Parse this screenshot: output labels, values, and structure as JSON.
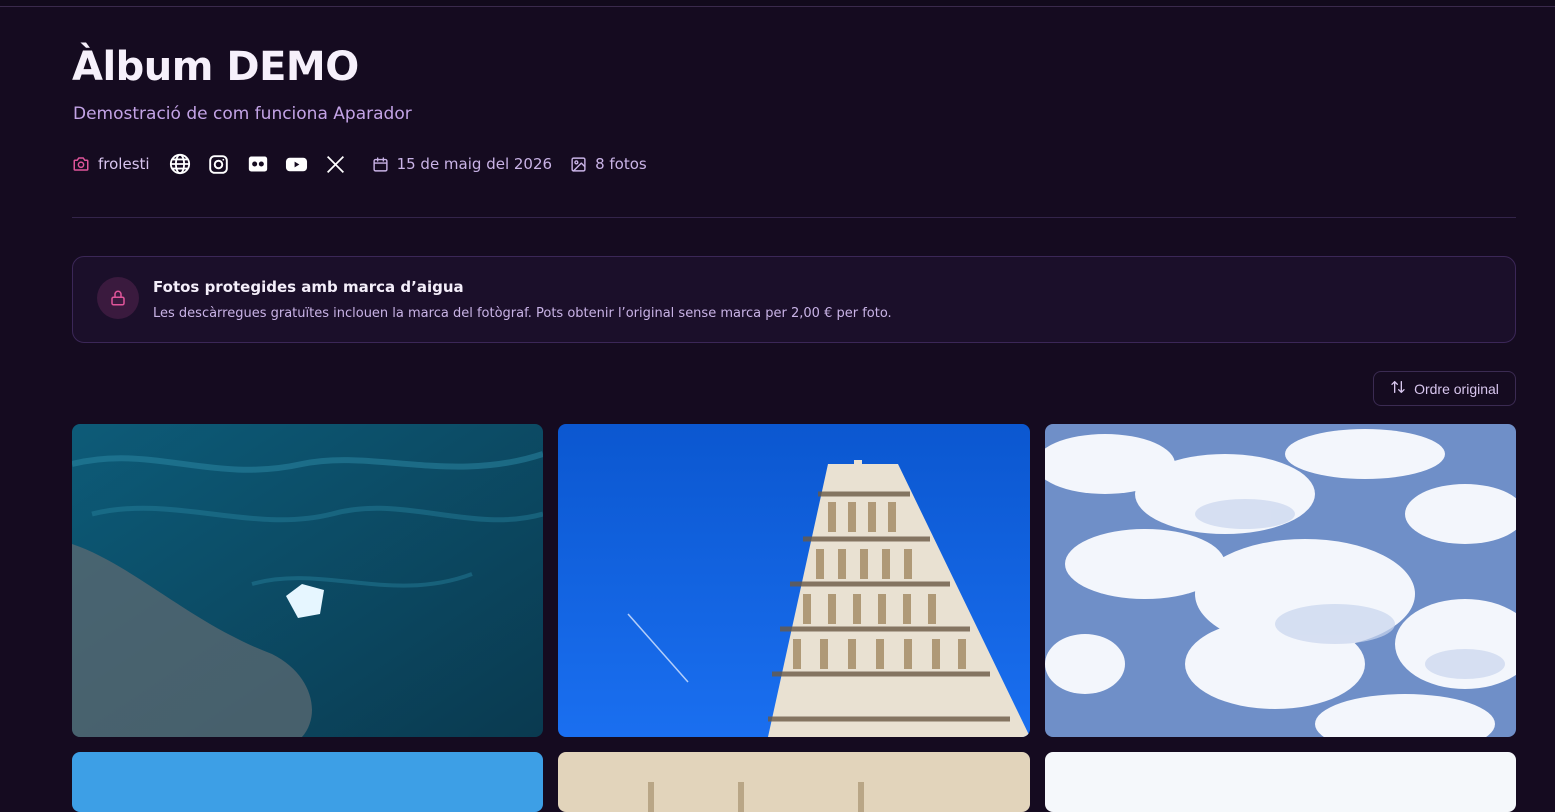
{
  "album": {
    "title": "Àlbum DEMO",
    "subtitle": "Demostració de com funciona Aparador"
  },
  "meta": {
    "author": "frolesti",
    "social_icons": [
      "globe-icon",
      "instagram-icon",
      "flickr-icon",
      "youtube-icon",
      "x-icon"
    ],
    "date": "15 de maig del 2026",
    "photo_count": "8 fotos"
  },
  "notice": {
    "title": "Fotos protegides amb marca d’aigua",
    "text": "Les descàrregues gratuïtes inclouen la marca del fotògraf. Pots obtenir l’original sense marca per 2,00 € per foto."
  },
  "toolbar": {
    "sort_label": "Ordre original"
  },
  "colors": {
    "background": "#150b20",
    "accent": "#e0559a",
    "muted_text": "#c3a3e6"
  }
}
